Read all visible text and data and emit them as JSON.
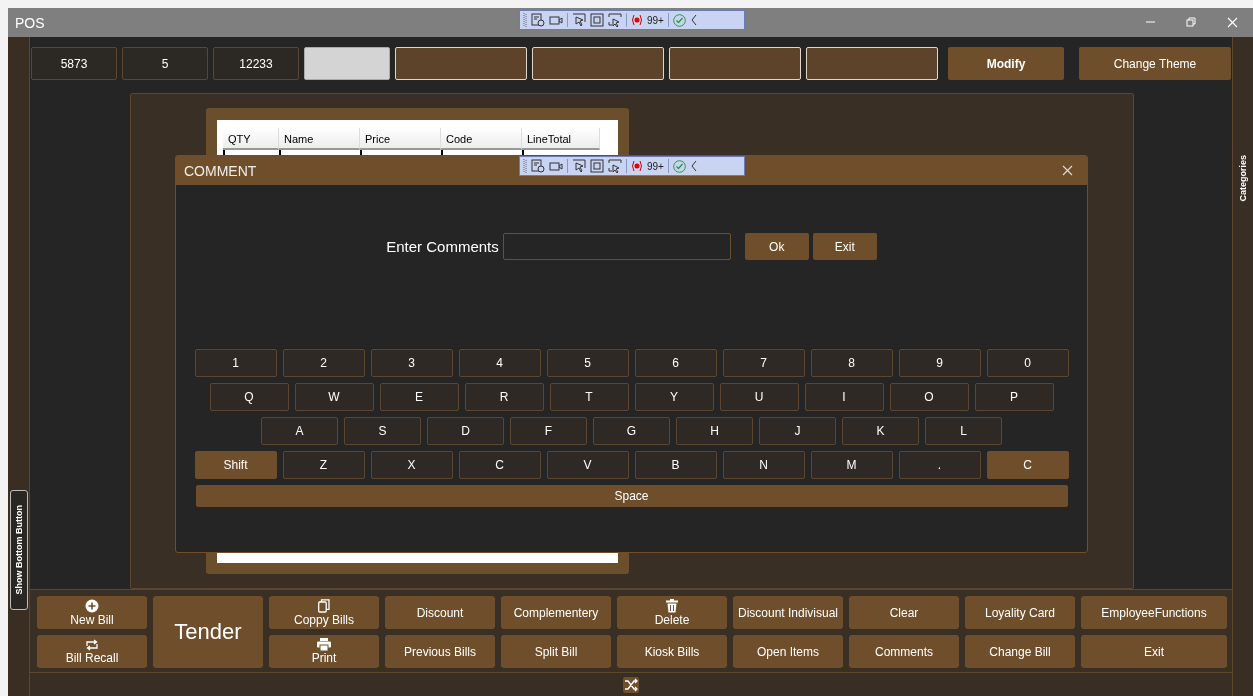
{
  "window": {
    "title": "POS"
  },
  "debug_toolbars": [
    {
      "badge": "99+"
    },
    {
      "badge": "99+"
    }
  ],
  "top_bar": {
    "fields": [
      {
        "kind": "value",
        "value": "5873"
      },
      {
        "kind": "value",
        "value": "5"
      },
      {
        "kind": "value",
        "value": "12233"
      },
      {
        "kind": "blank"
      },
      {
        "kind": "empty"
      },
      {
        "kind": "empty"
      },
      {
        "kind": "empty"
      },
      {
        "kind": "empty"
      }
    ],
    "buttons": [
      {
        "label": "Modify",
        "kind": "bold"
      },
      {
        "label": "Change Theme",
        "kind": "plain"
      }
    ]
  },
  "grid": {
    "columns": [
      "QTY",
      "Name",
      "Price",
      "Code",
      "LineTotal"
    ]
  },
  "dialog": {
    "title": "COMMENT",
    "prompt": "Enter Comments",
    "buttons": [
      "Ok",
      "Exit"
    ],
    "keyboard": [
      [
        {
          "label": "1",
          "kind": "char"
        },
        {
          "label": "2",
          "kind": "char"
        },
        {
          "label": "3",
          "kind": "char"
        },
        {
          "label": "4",
          "kind": "char"
        },
        {
          "label": "5",
          "kind": "char"
        },
        {
          "label": "6",
          "kind": "char"
        },
        {
          "label": "7",
          "kind": "char"
        },
        {
          "label": "8",
          "kind": "char"
        },
        {
          "label": "9",
          "kind": "char"
        },
        {
          "label": "0",
          "kind": "char"
        }
      ],
      [
        {
          "label": "Q",
          "kind": "char"
        },
        {
          "label": "W",
          "kind": "char"
        },
        {
          "label": "E",
          "kind": "char"
        },
        {
          "label": "R",
          "kind": "char"
        },
        {
          "label": "T",
          "kind": "char"
        },
        {
          "label": "Y",
          "kind": "char"
        },
        {
          "label": "U",
          "kind": "char"
        },
        {
          "label": "I",
          "kind": "char"
        },
        {
          "label": "O",
          "kind": "char"
        },
        {
          "label": "P",
          "kind": "char"
        }
      ],
      [
        {
          "label": "A",
          "kind": "char"
        },
        {
          "label": "S",
          "kind": "char"
        },
        {
          "label": "D",
          "kind": "char"
        },
        {
          "label": "F",
          "kind": "char"
        },
        {
          "label": "G",
          "kind": "char"
        },
        {
          "label": "H",
          "kind": "char"
        },
        {
          "label": "J",
          "kind": "char"
        },
        {
          "label": "K",
          "kind": "char"
        },
        {
          "label": "L",
          "kind": "char"
        }
      ],
      [
        {
          "label": "Shift",
          "kind": "function"
        },
        {
          "label": "Z",
          "kind": "char"
        },
        {
          "label": "X",
          "kind": "char"
        },
        {
          "label": "C",
          "kind": "char"
        },
        {
          "label": "V",
          "kind": "char"
        },
        {
          "label": "B",
          "kind": "char"
        },
        {
          "label": "N",
          "kind": "char"
        },
        {
          "label": "M",
          "kind": "char"
        },
        {
          "label": ".",
          "kind": "char"
        },
        {
          "label": "C",
          "kind": "function"
        }
      ],
      [
        {
          "label": "Space",
          "kind": "function"
        }
      ]
    ]
  },
  "bottom_buttons": [
    [
      {
        "label": "New Bill",
        "kind": "icon"
      },
      {
        "label": "Tender",
        "kind": "large"
      },
      {
        "label": "Coppy Bills",
        "kind": "icon"
      },
      {
        "label": "Discount",
        "kind": "text"
      },
      {
        "label": "Complementery",
        "kind": "text"
      },
      {
        "label": "Delete",
        "kind": "icon"
      },
      {
        "label": "Discount Indivisual",
        "kind": "text"
      },
      {
        "label": "Clear",
        "kind": "text"
      },
      {
        "label": "Loyality Card",
        "kind": "text"
      },
      {
        "label": "EmployeeFunctions",
        "kind": "text"
      }
    ],
    [
      {
        "label": "Bill Recall",
        "kind": "icon"
      },
      {
        "label": "Print",
        "kind": "icon"
      },
      {
        "label": "Previous Bills",
        "kind": "text"
      },
      {
        "label": "Split Bill",
        "kind": "text"
      },
      {
        "label": "Kiosk Bills",
        "kind": "text"
      },
      {
        "label": "Open Items",
        "kind": "text"
      },
      {
        "label": "Comments",
        "kind": "text"
      },
      {
        "label": "Change Bill",
        "kind": "text"
      },
      {
        "label": "Exit",
        "kind": "text"
      }
    ]
  ],
  "side_tabs": {
    "left": "Show Bottom Button",
    "right": "Categories"
  }
}
